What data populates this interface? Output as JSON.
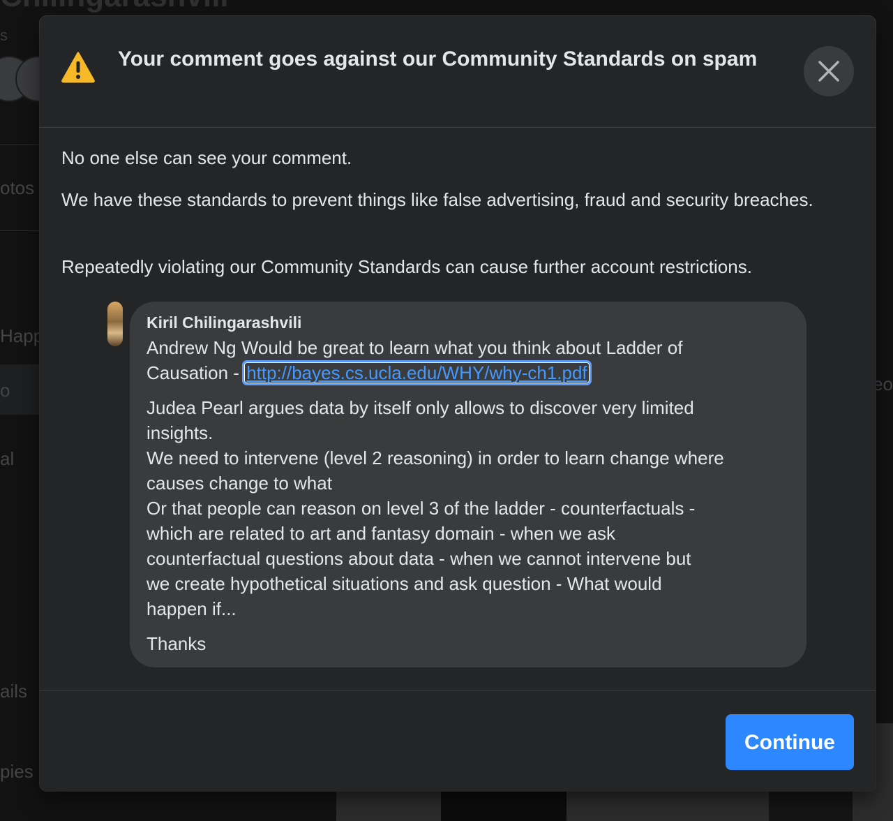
{
  "background": {
    "title_fragment": "Chilingarashvili",
    "left_labels": [
      "s",
      "otos",
      "Happ",
      "o",
      "al",
      "ails",
      "pies"
    ],
    "right_label": "eo"
  },
  "modal": {
    "title": "Your comment goes against our Community Standards on spam",
    "paragraphs": [
      "No one else can see your comment.",
      "We have these standards to prevent things like false advertising, fraud and security breaches.",
      "Repeatedly violating our Community Standards can cause further account restrictions."
    ],
    "comment": {
      "author": "Kiril Chilingarashvili",
      "line1": "Andrew Ng Would be great to learn what you think about Ladder of",
      "line2_prefix": "Causation - ",
      "link": "http://bayes.cs.ucla.edu/WHY/why-ch1.pdf",
      "lines": [
        "Judea Pearl argues data by itself only allows to discover very limited",
        "insights.",
        "We need to intervene (level 2 reasoning) in order to learn change where",
        "causes change to what",
        "Or that people can reason on level 3 of the ladder - counterfactuals -",
        "which are related to art and fantasy domain - when we ask",
        "counterfactual questions about data - when we cannot intervene but",
        "we create hypothetical situations and ask question - What would",
        "happen if..."
      ],
      "closing": "Thanks"
    },
    "continue_label": "Continue"
  },
  "colors": {
    "accent": "#2d88ff",
    "link": "#4599ff",
    "warning": "#f7b928",
    "modal_bg": "#242526",
    "bubble_bg": "#3a3b3c"
  },
  "icons": {
    "warning": "warning-triangle-icon",
    "close": "close-icon"
  }
}
